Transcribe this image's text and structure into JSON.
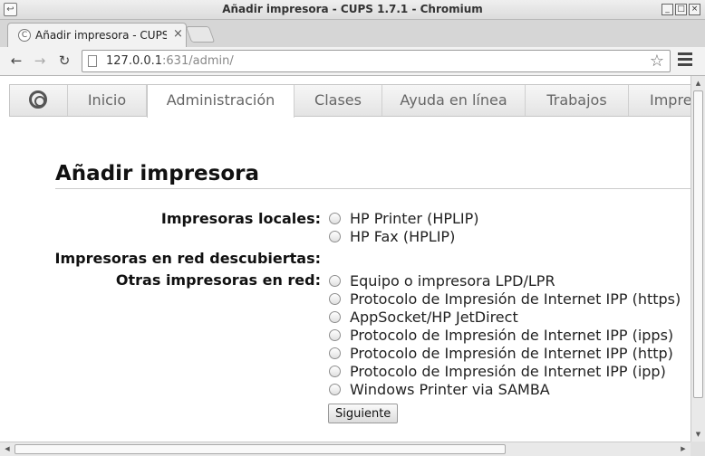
{
  "window": {
    "title": "Añadir impresora - CUPS 1.7.1 - Chromium",
    "minimize_glyph": "_",
    "maximize_glyph": "□",
    "close_glyph": "×"
  },
  "browser": {
    "tab_title": "Añadir impresora - CUPS",
    "tab_close": "×",
    "back_glyph": "←",
    "forward_glyph": "→",
    "reload_glyph": "↻",
    "url_host": "127.0.0.1",
    "url_rest": ":631/admin/",
    "star_glyph": "☆"
  },
  "cups_nav": {
    "tabs": [
      {
        "label": "Inicio"
      },
      {
        "label": "Administración",
        "active": true
      },
      {
        "label": "Clases"
      },
      {
        "label": "Ayuda en línea"
      },
      {
        "label": "Trabajos"
      },
      {
        "label": "Impresoras"
      }
    ]
  },
  "page": {
    "title": "Añadir impresora",
    "local_label": "Impresoras locales:",
    "local_options": [
      "HP Printer (HPLIP)",
      "HP Fax (HPLIP)"
    ],
    "discovered_label": "Impresoras en red descubiertas:",
    "other_label": "Otras impresoras en red:",
    "other_options": [
      "Equipo o impresora LPD/LPR",
      "Protocolo de Impresión de Internet IPP (https)",
      "AppSocket/HP JetDirect",
      "Protocolo de Impresión de Internet IPP (ipps)",
      "Protocolo de Impresión de Internet IPP (http)",
      "Protocolo de Impresión de Internet IPP (ipp)",
      "Windows Printer via SAMBA"
    ],
    "submit_label": "Siguiente"
  },
  "icons": {
    "app": "chromium-icon",
    "favicon": "cups-icon",
    "page": "page-icon",
    "star": "bookmark-star-icon",
    "menu": "hamburger-menu-icon"
  }
}
